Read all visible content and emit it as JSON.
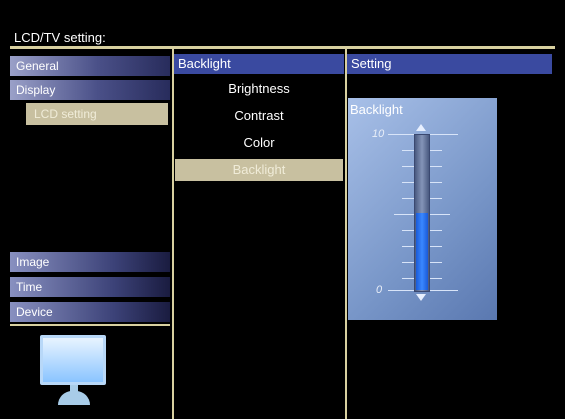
{
  "title": "LCD/TV setting:",
  "nav": {
    "items": [
      {
        "label": "General"
      },
      {
        "label": "Display"
      },
      {
        "label": "Image"
      },
      {
        "label": "Time"
      },
      {
        "label": "Device"
      }
    ],
    "sub_item": "LCD setting"
  },
  "menu": {
    "header": "Backlight",
    "options": [
      "Brightness",
      "Contrast",
      "Color",
      "Backlight"
    ],
    "selected": "Backlight"
  },
  "setting": {
    "header": "Setting",
    "label": "Backlight",
    "max_label": "10",
    "min_label": "0",
    "level_fraction": 0.5
  },
  "colors": {
    "accent": "#3a4aa0",
    "highlight": "#c8c0a0",
    "divider": "#d8d0a0"
  }
}
